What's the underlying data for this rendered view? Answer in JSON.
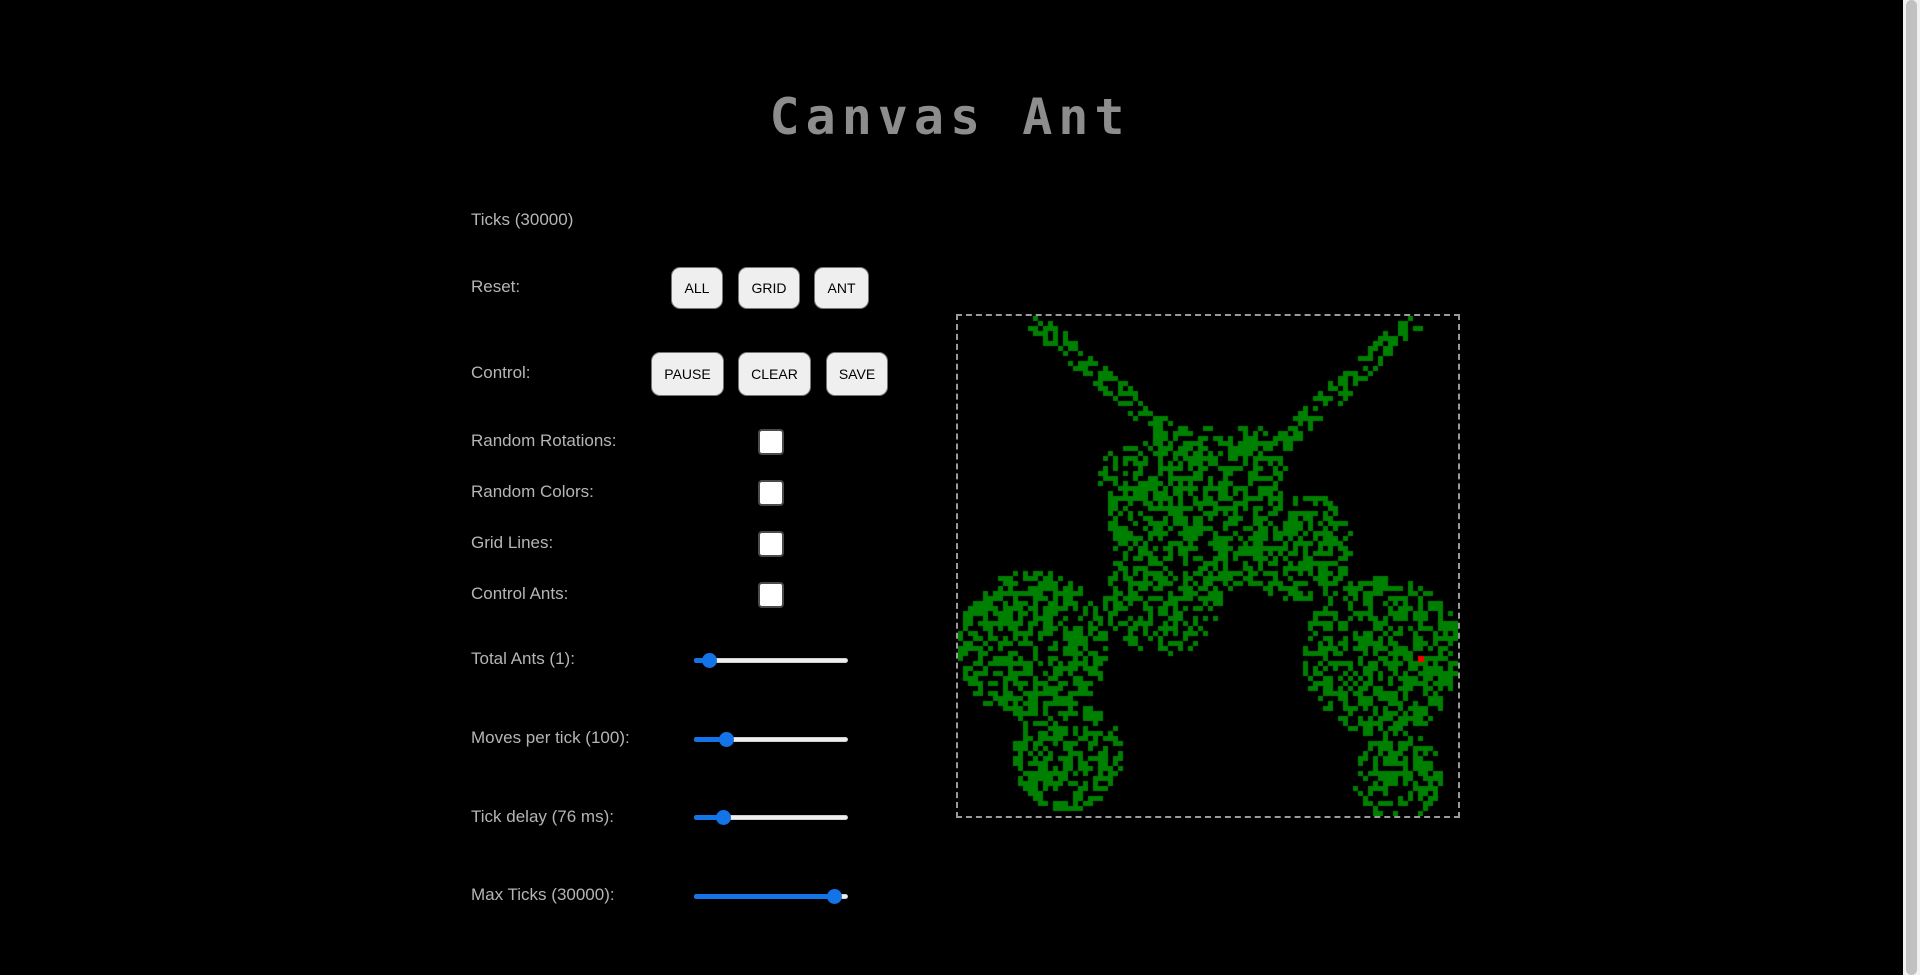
{
  "app": {
    "title": "Canvas Ant"
  },
  "status": {
    "ticks_label": "Ticks (30000)"
  },
  "reset": {
    "label": "Reset:",
    "all_label": "ALL",
    "grid_label": "GRID",
    "ant_label": "ANT"
  },
  "control": {
    "label": "Control:",
    "pause_label": "PAUSE",
    "clear_label": "CLEAR",
    "save_label": "SAVE"
  },
  "options": [
    {
      "label": "Random Rotations:",
      "checked": false
    },
    {
      "label": "Random Colors:",
      "checked": false
    },
    {
      "label": "Grid Lines:",
      "checked": false
    },
    {
      "label": "Control Ants:",
      "checked": false
    }
  ],
  "sliders": [
    {
      "label": "Total Ants (1):",
      "fraction": 0.1
    },
    {
      "label": "Moves per tick (100):",
      "fraction": 0.21
    },
    {
      "label": "Tick delay (76 ms):",
      "fraction": 0.19
    },
    {
      "label": "Max Ticks (30000):",
      "fraction": 0.91
    }
  ],
  "colors": {
    "accent": "#1473e6",
    "cell": "#008000",
    "ant": "#ff0000",
    "background": "#000000",
    "title": "#8d8d8d"
  }
}
